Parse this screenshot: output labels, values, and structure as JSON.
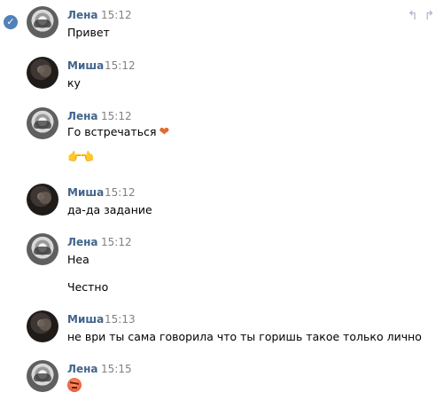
{
  "conversation": {
    "messages": [
      {
        "sender": "Лена",
        "time": "15:12",
        "lines": [
          "Привет"
        ]
      },
      {
        "sender": "Миша",
        "time": "15:12",
        "lines": [
          "ку"
        ]
      },
      {
        "sender": "Лена",
        "time": "15:12",
        "lines": [
          "Го встречаться"
        ],
        "emoji_after": "heart-emoji",
        "extra": [
          "hands-pointing-emoji"
        ]
      },
      {
        "sender": "Миша",
        "time": "15:12",
        "lines": [
          "да-да задание"
        ]
      },
      {
        "sender": "Лена",
        "time": "15:12",
        "lines": [
          "Неа",
          "Честно"
        ]
      },
      {
        "sender": "Миша",
        "time": "15:13",
        "lines": [
          "не ври ты сама говорила что ты горишь такое только лично"
        ]
      },
      {
        "sender": "Лена",
        "time": "15:15",
        "lines": [],
        "emoji_only": "angry-face-emoji"
      }
    ]
  },
  "icons": {
    "selected": "checkmark-icon",
    "reply": "reply-icon",
    "forward": "forward-icon"
  },
  "colors": {
    "name": "#42648b",
    "time": "#828282",
    "accent": "#5181b8"
  }
}
